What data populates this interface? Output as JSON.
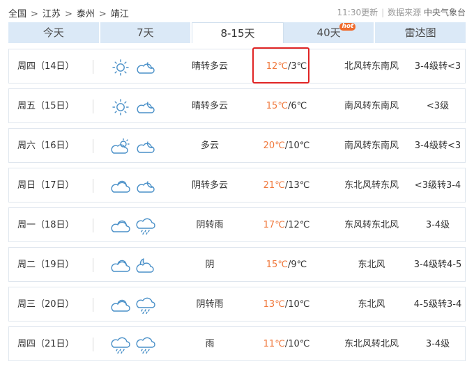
{
  "breadcrumb": {
    "items": [
      "全国",
      "江苏",
      "泰州",
      "靖江"
    ],
    "separator": ">"
  },
  "update": {
    "time": "11:30更新",
    "source_label": "数据来源",
    "source_org": "中央气象台"
  },
  "tabs": [
    {
      "label": "今天",
      "active": false
    },
    {
      "label": "7天",
      "active": false
    },
    {
      "label": "8-15天",
      "active": true
    },
    {
      "label": "40天",
      "active": false,
      "badge": "hot"
    },
    {
      "label": "雷达图",
      "active": false
    }
  ],
  "forecast": [
    {
      "date": "周四（14日）",
      "icons": [
        "sun-icon",
        "cloud-icon"
      ],
      "desc": "晴转多云",
      "high": "12℃",
      "low": "/3℃",
      "wind": "北风转东南风",
      "level": "3-4级转<3",
      "highlighted": true
    },
    {
      "date": "周五（15日）",
      "icons": [
        "sun-icon",
        "cloud-icon"
      ],
      "desc": "晴转多云",
      "high": "15℃",
      "low": "/6℃",
      "wind": "南风转东南风",
      "level": "<3级"
    },
    {
      "date": "周六（16日）",
      "icons": [
        "partly-cloudy-icon",
        "cloud-icon"
      ],
      "desc": "多云",
      "high": "20℃",
      "low": "/10℃",
      "wind": "南风转东南风",
      "level": "3-4级转<3"
    },
    {
      "date": "周日（17日）",
      "icons": [
        "overcast-icon",
        "cloud-icon"
      ],
      "desc": "阴转多云",
      "high": "21℃",
      "low": "/13℃",
      "wind": "东北风转东风",
      "level": "<3级转3-4"
    },
    {
      "date": "周一（18日）",
      "icons": [
        "overcast-icon",
        "rain-icon"
      ],
      "desc": "阴转雨",
      "high": "17℃",
      "low": "/12℃",
      "wind": "东风转东北风",
      "level": "3-4级"
    },
    {
      "date": "周二（19日）",
      "icons": [
        "overcast-icon",
        "cloudy-night-icon"
      ],
      "desc": "阴",
      "high": "15℃",
      "low": "/9℃",
      "wind": "东北风",
      "level": "3-4级转4-5"
    },
    {
      "date": "周三（20日）",
      "icons": [
        "overcast-icon",
        "rain-icon"
      ],
      "desc": "阴转雨",
      "high": "13℃",
      "low": "/10℃",
      "wind": "东北风",
      "level": "4-5级转3-4"
    },
    {
      "date": "周四（21日）",
      "icons": [
        "rain-icon",
        "rain-icon"
      ],
      "desc": "雨",
      "high": "11℃",
      "low": "/10℃",
      "wind": "东北风转北风",
      "level": "3-4级"
    }
  ],
  "colors": {
    "tab_bg": "#dbe9f7",
    "temp_high": "#f0793d",
    "icon_stroke": "#4a90c8",
    "highlight_border": "#e02424"
  }
}
